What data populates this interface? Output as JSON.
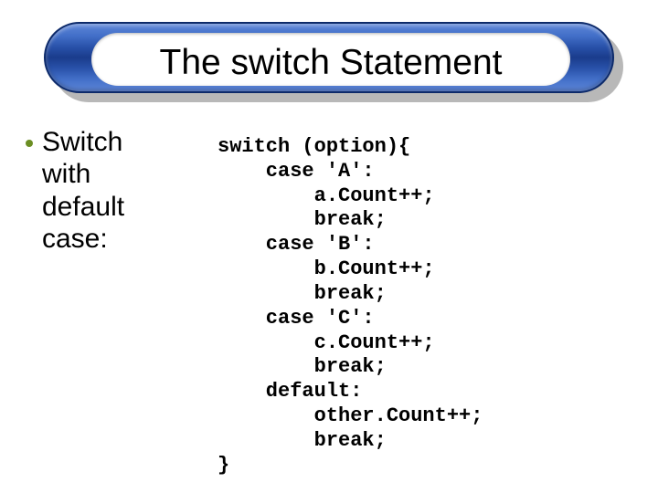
{
  "title": "The switch Statement",
  "bullet": {
    "line1": "Switch",
    "line2": "with",
    "line3": "default",
    "line4": "case:"
  },
  "code": {
    "l1": "switch (option){",
    "l2": "    case 'A':",
    "l3": "        a.Count++;",
    "l4": "        break;",
    "l5": "    case 'B':",
    "l6": "        b.Count++;",
    "l7": "        break;",
    "l8": "    case 'C':",
    "l9": "        c.Count++;",
    "l10": "        break;",
    "l11": "    default:",
    "l12": "        other.Count++;",
    "l13": "        break;",
    "l14": "}"
  }
}
